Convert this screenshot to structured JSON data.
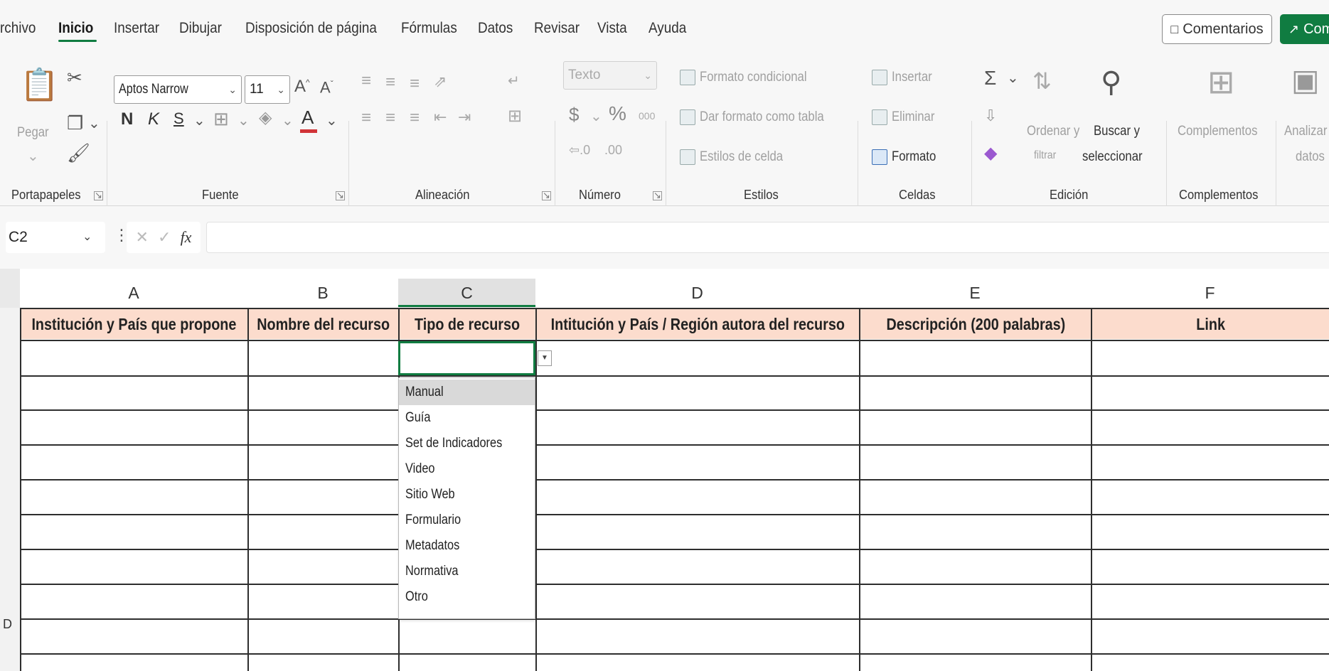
{
  "menu": {
    "items": [
      "rchivo",
      "Inicio",
      "Insertar",
      "Dibujar",
      "Disposición de página",
      "Fórmulas",
      "Datos",
      "Revisar",
      "Vista",
      "Ayuda"
    ],
    "active": "Inicio"
  },
  "header_buttons": {
    "comments": "Comentarios",
    "share": "Com"
  },
  "ribbon": {
    "clipboard": {
      "paste": "Pegar",
      "label": "Portapapeles"
    },
    "font": {
      "name": "Aptos Narrow",
      "size": "11",
      "bold": "N",
      "italic": "K",
      "underline": "S",
      "label": "Fuente",
      "font_color": "#d13438"
    },
    "alignment": {
      "label": "Alineación"
    },
    "number": {
      "format": "Texto",
      "currency": "$",
      "percent": "%",
      "thousands": "000",
      "label": "Número"
    },
    "styles": {
      "conditional": "Formato condicional",
      "as_table": "Dar formato como tabla",
      "cell_styles": "Estilos de celda",
      "label": "Estilos"
    },
    "cells": {
      "insert": "Insertar",
      "delete": "Eliminar",
      "format": "Formato",
      "label": "Celdas"
    },
    "editing": {
      "sort_line1": "Ordenar y",
      "sort_line2": "filtrar",
      "find_line1": "Buscar y",
      "find_line2": "seleccionar",
      "label": "Edición"
    },
    "addins": {
      "button": "Complementos",
      "label": "Complementos"
    },
    "analyze": {
      "line1": "Analizar",
      "line2": "datos"
    }
  },
  "formula_bar": {
    "name_box": "C2",
    "fx": "fx",
    "content": ""
  },
  "sheet": {
    "columns": [
      "A",
      "B",
      "C",
      "D",
      "E",
      "F"
    ],
    "selected_column": "C",
    "headers": [
      "Institución y País que propone",
      "Nombre del recurso",
      "Tipo de recurso",
      "Intitución y País / Región autora del recurso",
      "Descripción (200 palabras)",
      "Link"
    ],
    "row_numbers": [
      "",
      "",
      "",
      "",
      "",
      "",
      "",
      "",
      "",
      "D",
      ""
    ],
    "header_fill": "#fcdccd",
    "accent": "#107c41"
  },
  "dropdown": {
    "options": [
      "Manual",
      "Guía",
      "Set de Indicadores",
      "Video",
      "Sitio Web",
      "Formulario",
      "Metadatos",
      "Normativa",
      "Otro"
    ],
    "highlighted": "Manual"
  }
}
